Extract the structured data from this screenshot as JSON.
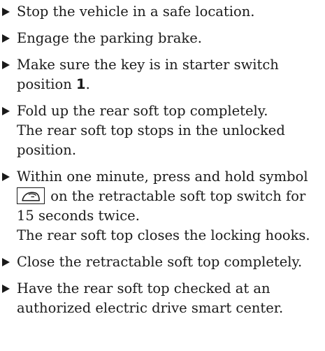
{
  "steps": [
    {
      "text": "Stop the vehicle in a safe location."
    },
    {
      "text": "Engage the parking brake."
    },
    {
      "text_before": "Make sure the key is in starter switch position ",
      "position_value": "1",
      "text_after": "."
    },
    {
      "text": "Fold up the rear soft top completely.",
      "result": "The rear soft top stops in the unlocked position."
    },
    {
      "text_before": "Within one minute, press and hold symbol",
      "symbol_icon": "soft-top-icon",
      "text_after": "on the retractable soft top switch for 15 seconds twice.",
      "result": "The rear soft top closes the locking hooks."
    },
    {
      "text": "Close the retractable soft top completely."
    },
    {
      "text": "Have the rear soft top checked at an authorized electric drive smart center."
    }
  ]
}
